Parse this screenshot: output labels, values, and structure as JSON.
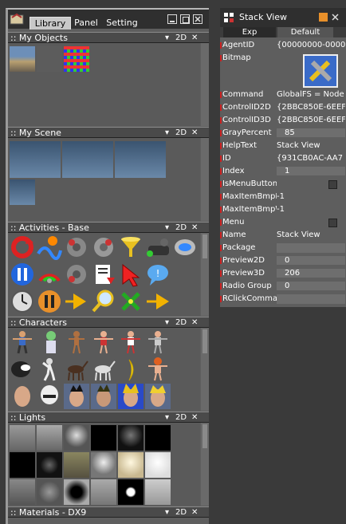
{
  "left_panel": {
    "tabs": [
      {
        "label": "Library",
        "active": true
      },
      {
        "label": "Panel",
        "active": false
      },
      {
        "label": "Setting",
        "active": false
      }
    ],
    "section_ctrl_2d": "2D",
    "sections": [
      {
        "title": ":: My Objects"
      },
      {
        "title": ":: My Scene"
      },
      {
        "title": ":: Activities - Base"
      },
      {
        "title": ":: Characters"
      },
      {
        "title": ":: Lights"
      },
      {
        "title": ":: Materials - DX9"
      }
    ]
  },
  "right_panel": {
    "title": "Stack View",
    "tabs": [
      "Exp",
      "Default"
    ],
    "properties": [
      {
        "name": "AgentID",
        "value": "{00000000-0000"
      },
      {
        "name": "Bitmap",
        "value": ""
      },
      {
        "name": "Command",
        "value": "GlobalFS = Node"
      },
      {
        "name": "ControlID2D",
        "value": "{2BBC850E-6EEF"
      },
      {
        "name": "ControlID3D",
        "value": "{2BBC850E-6EEF"
      },
      {
        "name": "GrayPercent",
        "value": "85"
      },
      {
        "name": "HelpText",
        "value": "Stack View"
      },
      {
        "name": "ID",
        "value": "{931CB0AC-AA7"
      },
      {
        "name": "Index",
        "value": "1"
      },
      {
        "name": "IsMenuButton",
        "value": ""
      },
      {
        "name": "MaxItemBmpHei",
        "value": "-1"
      },
      {
        "name": "MaxItemBmpWid",
        "value": "-1"
      },
      {
        "name": "Menu",
        "value": ""
      },
      {
        "name": "Name",
        "value": "Stack View"
      },
      {
        "name": "Package",
        "value": ""
      },
      {
        "name": "Preview2D",
        "value": "0"
      },
      {
        "name": "Preview3D",
        "value": "206"
      },
      {
        "name": "Radio Group",
        "value": "0"
      },
      {
        "name": "RClickCommand",
        "value": ""
      }
    ]
  }
}
